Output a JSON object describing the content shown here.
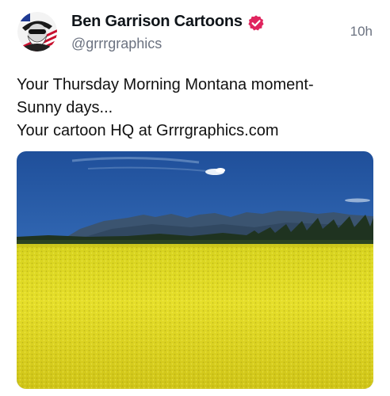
{
  "post": {
    "author": {
      "display_name": "Ben Garrison Cartoons",
      "handle": "@grrrgraphics",
      "verified_icon": "verified-badge-icon",
      "verified_color": "#e0245e"
    },
    "timestamp": "10h",
    "text_lines": [
      "Your Thursday Morning Montana moment-",
      "Sunny days...",
      "Your cartoon HQ at Grrrgraphics.com"
    ],
    "media": {
      "icon": "landscape-photo",
      "colors": {
        "sky": "#2d5fa8",
        "mountains": "#3b5470",
        "field": "#e6df2a"
      }
    }
  }
}
